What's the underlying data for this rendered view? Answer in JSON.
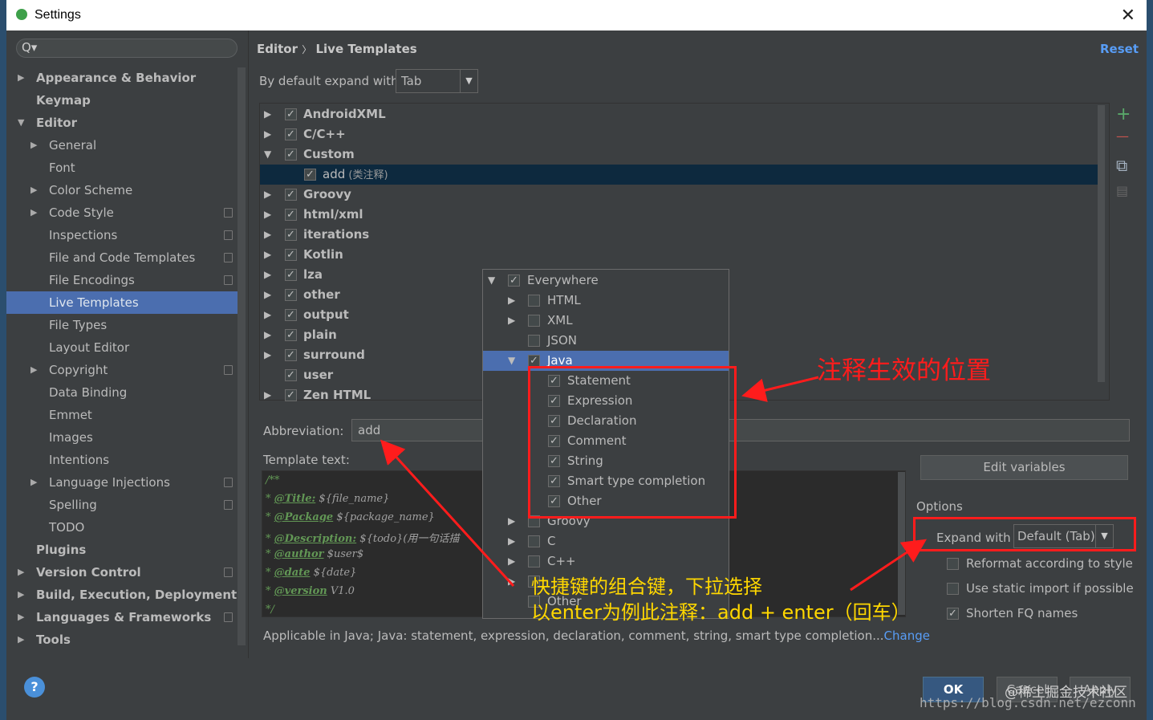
{
  "window": {
    "title": "Settings"
  },
  "sidebar": {
    "search_placeholder": "Q▾",
    "items": [
      {
        "label": "Appearance & Behavior",
        "arrow": "▶",
        "bold": true
      },
      {
        "label": "Keymap",
        "bold": true
      },
      {
        "label": "Editor",
        "arrow": "▼",
        "bold": true
      },
      {
        "label": "General",
        "arrow": "▶"
      },
      {
        "label": "Font"
      },
      {
        "label": "Color Scheme",
        "arrow": "▶"
      },
      {
        "label": "Code Style",
        "arrow": "▶"
      },
      {
        "label": "Inspections"
      },
      {
        "label": "File and Code Templates"
      },
      {
        "label": "File Encodings"
      },
      {
        "label": "Live Templates"
      },
      {
        "label": "File Types"
      },
      {
        "label": "Layout Editor"
      },
      {
        "label": "Copyright",
        "arrow": "▶"
      },
      {
        "label": "Data Binding"
      },
      {
        "label": "Emmet"
      },
      {
        "label": "Images"
      },
      {
        "label": "Intentions"
      },
      {
        "label": "Language Injections",
        "arrow": "▶"
      },
      {
        "label": "Spelling"
      },
      {
        "label": "TODO"
      },
      {
        "label": "Plugins",
        "bold": true
      },
      {
        "label": "Version Control",
        "arrow": "▶",
        "bold": true
      },
      {
        "label": "Build, Execution, Deployment",
        "arrow": "▶",
        "bold": true
      },
      {
        "label": "Languages & Frameworks",
        "arrow": "▶",
        "bold": true
      },
      {
        "label": "Tools",
        "arrow": "▶",
        "bold": true
      }
    ]
  },
  "header": {
    "breadcrumb_editor": "Editor",
    "breadcrumb_sep": "〉",
    "breadcrumb_page": "Live Templates",
    "reset": "Reset"
  },
  "expand": {
    "label": "By default expand with",
    "value": "Tab",
    "dropdown": "▼"
  },
  "templates": [
    {
      "label": "AndroidXML",
      "arrow": "▶",
      "checked": true
    },
    {
      "label": "C/C++",
      "arrow": "▶",
      "checked": true
    },
    {
      "label": "Custom",
      "arrow": "▼",
      "checked": true
    },
    {
      "label": "add",
      "desc": "(类注释)",
      "checked": true,
      "child": true
    },
    {
      "label": "Groovy",
      "arrow": "▶",
      "checked": true
    },
    {
      "label": "html/xml",
      "arrow": "▶",
      "checked": true
    },
    {
      "label": "iterations",
      "arrow": "▶",
      "checked": true
    },
    {
      "label": "Kotlin",
      "arrow": "▶",
      "checked": true
    },
    {
      "label": "lza",
      "arrow": "▶",
      "checked": true
    },
    {
      "label": "other",
      "arrow": "▶",
      "checked": true
    },
    {
      "label": "output",
      "arrow": "▶",
      "checked": true
    },
    {
      "label": "plain",
      "arrow": "▶",
      "checked": true
    },
    {
      "label": "surround",
      "arrow": "▶",
      "checked": true
    },
    {
      "label": "user",
      "checked": true
    },
    {
      "label": "Zen HTML",
      "arrow": "▶",
      "checked": true
    }
  ],
  "toolbar": {
    "add": "+",
    "remove": "—",
    "copy": "⧉",
    "move": "▤"
  },
  "abbreviation": {
    "label": "Abbreviation:",
    "value": "add"
  },
  "template_text": {
    "label": "Template text:",
    "lines": [
      {
        "prefix": "/**",
        "tag": "",
        "val": ""
      },
      {
        "prefix": "* ",
        "tag": "@Title:",
        "val": " ${file_name}"
      },
      {
        "prefix": "* ",
        "tag": "@Package",
        "val": " ${package_name}"
      },
      {
        "prefix": "* ",
        "tag": "@Description:",
        "val": " ${todo}(用一句话描"
      },
      {
        "prefix": "* ",
        "tag": "@author",
        "val": " $user$"
      },
      {
        "prefix": "* ",
        "tag": "@date",
        "val": " ${date}"
      },
      {
        "prefix": "* ",
        "tag": "@version",
        "val": " V1.0"
      },
      {
        "prefix": "*/",
        "tag": "",
        "val": ""
      }
    ]
  },
  "edit_variables": "Edit variables",
  "options": {
    "label": "Options",
    "expand_with_label": "Expand with",
    "expand_with_value": "Default (Tab)",
    "dropdown": "▼",
    "checks": [
      {
        "label": "Reformat according to style",
        "checked": false
      },
      {
        "label": "Use static import if possible",
        "checked": false
      },
      {
        "label": "Shorten FQ names",
        "checked": true
      }
    ]
  },
  "applicable": {
    "text": "Applicable in Java; Java: statement, expression, declaration, comment, string, smart type completion...",
    "link": "Change"
  },
  "context_popup": [
    {
      "label": "Everywhere",
      "arrow": "▼",
      "checked": true,
      "indent": 0
    },
    {
      "label": "HTML",
      "arrow": "▶",
      "checked": false,
      "indent": 1
    },
    {
      "label": "XML",
      "arrow": "▶",
      "checked": false,
      "indent": 1
    },
    {
      "label": "JSON",
      "checked": false,
      "indent": 1
    },
    {
      "label": "Java",
      "arrow": "▼",
      "checked": true,
      "indent": 1
    },
    {
      "label": "Statement",
      "checked": true,
      "indent": 2
    },
    {
      "label": "Expression",
      "checked": true,
      "indent": 2
    },
    {
      "label": "Declaration",
      "checked": true,
      "indent": 2
    },
    {
      "label": "Comment",
      "checked": true,
      "indent": 2
    },
    {
      "label": "String",
      "checked": true,
      "indent": 2
    },
    {
      "label": "Smart type completion",
      "checked": true,
      "indent": 2
    },
    {
      "label": "Other",
      "checked": true,
      "indent": 2
    },
    {
      "label": "Groovy",
      "arrow": "▶",
      "checked": false,
      "indent": 1
    },
    {
      "label": "C",
      "arrow": "▶",
      "checked": false,
      "indent": 1
    },
    {
      "label": "C++",
      "arrow": "▶",
      "checked": false,
      "indent": 1
    },
    {
      "label": "",
      "arrow": "▶",
      "checked": false,
      "indent": 1
    },
    {
      "label": "Other",
      "checked": false,
      "indent": 1
    }
  ],
  "annotations": {
    "position_note": "注释生效的位置",
    "shortcut_note_1": "快捷键的组合键，下拉选择",
    "shortcut_note_2": "以enter为例此注释：add + enter（回车）"
  },
  "buttons": {
    "help": "?",
    "ok": "OK",
    "cancel": "Cancel",
    "apply": "Apply"
  },
  "watermark": {
    "site": "@稀土掘金技术社区",
    "url": "https://blog.csdn.net/ezconn"
  },
  "colors": {
    "accent": "#4b6eaf",
    "annotation": "#ff1c1c",
    "annotation_text_yellow": "#ffd700",
    "link": "#589df6"
  }
}
